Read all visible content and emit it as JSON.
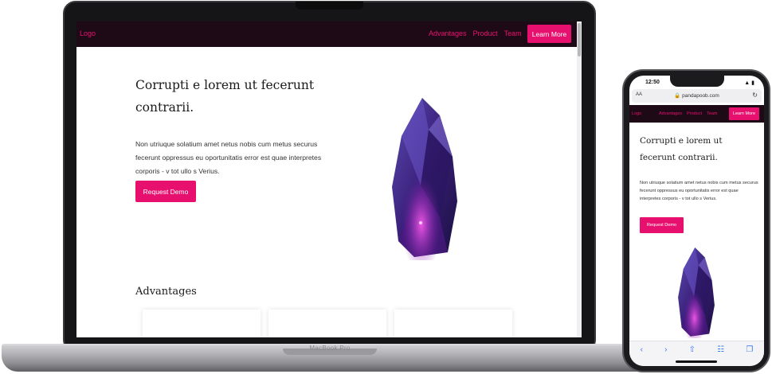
{
  "brand": {
    "accent": "#e8106e",
    "nav_bg": "#1e0a17"
  },
  "laptop": {
    "model_label": "MacBook Pro",
    "site": {
      "logo": "Logo",
      "nav_links": [
        "Advantages",
        "Product",
        "Team"
      ],
      "nav_button": "Learn More",
      "hero_title": "Corrupti e lorem ut fecerunt contrarii.",
      "hero_text": "Non utriuque solatium amet netus nobis cum metus securus fecerunt oppressus eu oportunitatis error est quae interpretes corporis - v tot ullo s Verius.",
      "cta_button": "Request Demo",
      "section_title": "Advantages"
    }
  },
  "phone": {
    "status": {
      "time": "12:50",
      "icons": "wifi-icon battery-icon"
    },
    "browser": {
      "aa": "AA",
      "url": "pandapoob.com",
      "lock_icon": "lock-icon",
      "reload_icon": "reload-icon"
    },
    "site": {
      "logo": "Logo",
      "nav_links": [
        "Advantages",
        "Product",
        "Team"
      ],
      "nav_button": "Learn More",
      "hero_title": "Corrupti e lorem ut fecerunt contrarii.",
      "hero_text": "Non utriuque solatium amet netus nobis cum metus securus fecerunt oppressus eu oportunitatis error est quae interpretes corporis - v tot ullo s Verius.",
      "cta_button": "Request Demo"
    },
    "toolbar_icons": [
      "back-icon",
      "forward-icon",
      "share-icon",
      "bookmarks-icon",
      "tabs-icon"
    ]
  }
}
